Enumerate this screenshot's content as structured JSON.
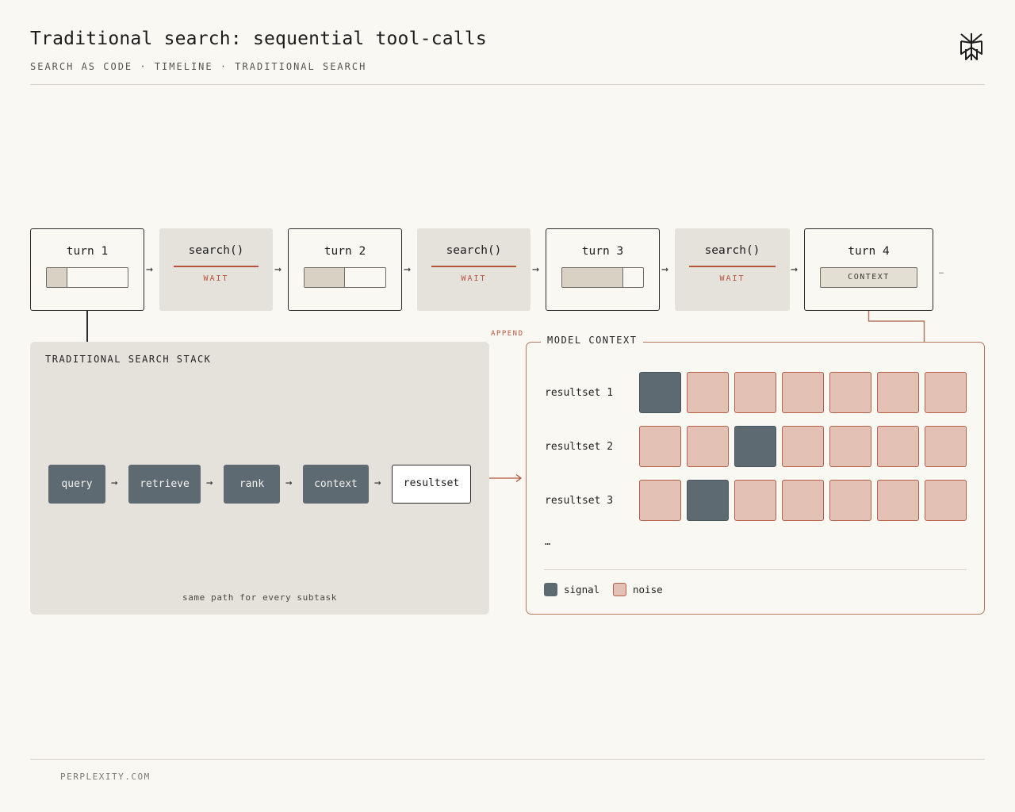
{
  "header": {
    "title": "Traditional search: sequential tool-calls",
    "subtitle": "SEARCH AS CODE · TIMELINE · TRADITIONAL SEARCH",
    "logo_icon": "perplexity-logo-icon"
  },
  "timeline": {
    "turns": [
      {
        "label": "turn 1",
        "progress": 0.25
      },
      {
        "label": "turn 2",
        "progress": 0.5
      },
      {
        "label": "turn 3",
        "progress": 0.75
      },
      {
        "label": "turn 4",
        "pill": "CONTEXT"
      }
    ],
    "searches": [
      {
        "label": "search()",
        "status": "WAIT"
      },
      {
        "label": "search()",
        "status": "WAIT"
      },
      {
        "label": "search()",
        "status": "WAIT"
      }
    ],
    "arrow": "→",
    "more": "…"
  },
  "stack": {
    "title": "TRADITIONAL SEARCH STACK",
    "steps": [
      "query",
      "retrieve",
      "rank",
      "context",
      "resultset"
    ],
    "arrow": "→",
    "caption": "same path for every subtask"
  },
  "append_label": "APPEND",
  "model_context": {
    "title": "MODEL CONTEXT",
    "resultsets": [
      {
        "label": "resultset 1",
        "cells": [
          "signal",
          "noise",
          "noise",
          "noise",
          "noise",
          "noise",
          "noise"
        ]
      },
      {
        "label": "resultset 2",
        "cells": [
          "noise",
          "noise",
          "signal",
          "noise",
          "noise",
          "noise",
          "noise"
        ]
      },
      {
        "label": "resultset 3",
        "cells": [
          "noise",
          "signal",
          "noise",
          "noise",
          "noise",
          "noise",
          "noise"
        ]
      }
    ],
    "more": "…",
    "legend": {
      "signal": "signal",
      "noise": "noise"
    },
    "colors": {
      "signal": "#5d6a72",
      "noise": "#e3c1b4",
      "accent": "#b5543a"
    }
  },
  "footer": "PERPLEXITY.COM"
}
